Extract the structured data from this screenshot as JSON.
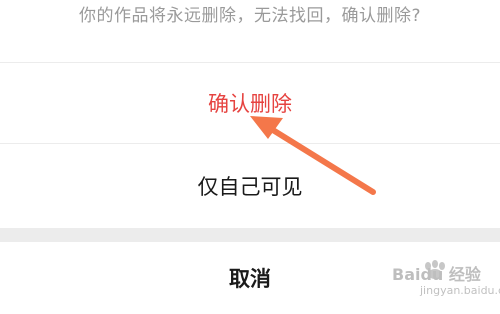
{
  "dialog": {
    "message": "你的作品将永远删除，无法找回，确认删除?",
    "confirm_label": "确认删除",
    "private_label": "仅自己可见",
    "cancel_label": "取消"
  },
  "watermark": {
    "brand_text": "Baidu 经验",
    "url_text": "jingyan.baidu.com"
  },
  "colors": {
    "confirm": "#e64340",
    "arrow": "#f4774a",
    "separator": "#ececec"
  }
}
